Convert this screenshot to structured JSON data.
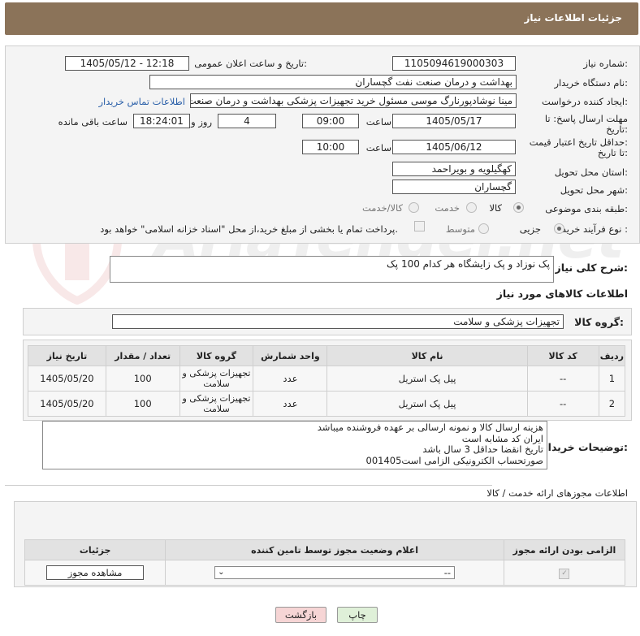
{
  "header": {
    "title": "جزئیات اطلاعات نیاز"
  },
  "form": {
    "need_number_label": "شماره نیاز:",
    "need_number": "1105094619000303",
    "announce_label": "تاریخ و ساعت اعلان عمومی:",
    "announce_value": "1405/05/12 - 12:18",
    "buyer_org_label": "نام دستگاه خریدار:",
    "buyer_org": "بهداشت و درمان صنعت نفت گچساران",
    "creator_label": "ایجاد کننده درخواست:",
    "creator": "مینا نوشادپورنارگ موسی مسئول خرید تجهیزات پزشکی  بهداشت و درمان صنعت",
    "buyer_contact_link": "اطلاعات تماس خریدار",
    "deadline_label_1": "مهلت ارسال پاسخ: تا",
    "deadline_label_2": "تاریخ:",
    "deadline_date": "1405/05/17",
    "time_label": "ساعت",
    "deadline_time": "09:00",
    "days_count": "4",
    "days_label": "روز و",
    "remaining_time": "18:24:01",
    "remaining_label": "ساعت باقی مانده",
    "validity_label_1": "حداقل تاریخ اعتبار قیمت:",
    "validity_label_2": "تا تاریخ:",
    "validity_date": "1405/06/12",
    "validity_time": "10:00",
    "province_label": "استان محل تحویل:",
    "province": "کهگیلویه و بویراحمد",
    "city_label": "شهر محل تحویل:",
    "city": "گچساران",
    "category_label": "طبقه بندی موضوعی:",
    "category_options": [
      "کالا",
      "خدمت",
      "کالا/خدمت"
    ],
    "process_label": "نوع فرآیند خرید :",
    "process_options": [
      "جزیی",
      "متوسط"
    ],
    "payment_note": "پرداخت تمام یا بخشی از مبلغ خرید،از محل \"اسناد خزانه اسلامی\" خواهد بود.",
    "description_label": "شرح کلی نیاز:",
    "description": "پک نوزاد و پک زایشگاه هر کدام 100 پک",
    "goods_info_title": "اطلاعات کالاهای مورد نیاز",
    "goods_group_label": "گروه کالا:",
    "goods_group": "تجهیزات پزشکی و سلامت"
  },
  "items_table": {
    "headers": [
      "ردیف",
      "کد کالا",
      "نام کالا",
      "واحد شمارش",
      "گروه کالا",
      "تعداد / مقدار",
      "تاریخ نیاز"
    ],
    "rows": [
      [
        "1",
        "--",
        "پیل پک استریل",
        "عدد",
        "تجهیزات پزشکی و سلامت",
        "100",
        "1405/05/20"
      ],
      [
        "2",
        "--",
        "پیل پک استریل",
        "عدد",
        "تجهیزات پزشکی و سلامت",
        "100",
        "1405/05/20"
      ]
    ]
  },
  "buyer_notes": {
    "label": "توضیحات خریدار:",
    "lines": [
      "هزینه ارسال کالا و نمونه ارسالی بر عهده فروشنده میباشد",
      "ایران کد مشابه است",
      "تاریخ انقضا حداقل 3 سال باشد",
      "صورتحساب الکترونیکی الزامی است001405"
    ]
  },
  "permits": {
    "section_title": "اطلاعات مجوزهای ارائه خدمت / کالا",
    "headers": [
      "الزامی بودن ارائه مجوز",
      "اعلام وضعیت مجوز توسط تامین کننده",
      "جزئیات"
    ],
    "select_value": "--",
    "view_button": "مشاهده مجوز"
  },
  "footer": {
    "print_button": "چاپ",
    "back_button": "بازگشت"
  },
  "watermark_text": "AriaTender.net",
  "colors": {
    "header_bg": "#8b7359",
    "link": "#2a5fa8",
    "back_btn_bg": "#f6d5d5",
    "print_btn_bg": "#dff0d8"
  }
}
